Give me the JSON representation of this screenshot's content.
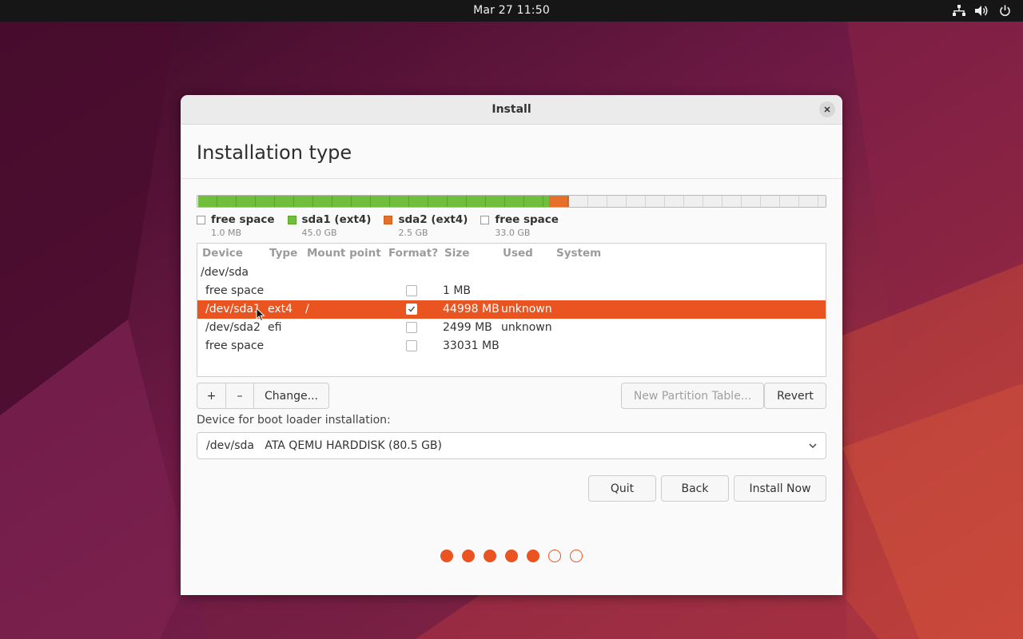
{
  "topbar": {
    "clock": "Mar 27  11:50",
    "tray_icons": [
      "network-icon",
      "volume-icon",
      "power-icon"
    ]
  },
  "dialog": {
    "title": "Install",
    "heading": "Installation type"
  },
  "partition_bar": {
    "segments": [
      {
        "name": "free space",
        "share": 0.0,
        "color": "#efefef"
      },
      {
        "name": "sda1",
        "share": 0.559,
        "color": "#6fbf3c"
      },
      {
        "name": "sda2",
        "share": 0.031,
        "color": "#e6702a"
      },
      {
        "name": "free space",
        "share": 0.41,
        "color": "#efefef"
      }
    ]
  },
  "legend": [
    {
      "label": "free space",
      "size": "1.0 MB",
      "color": "#ffffff"
    },
    {
      "label": "sda1 (ext4)",
      "size": "45.0 GB",
      "color": "#6fbf3c"
    },
    {
      "label": "sda2 (ext4)",
      "size": "2.5 GB",
      "color": "#e6702a"
    },
    {
      "label": "free space",
      "size": "33.0 GB",
      "color": "#ffffff"
    }
  ],
  "table": {
    "headers": {
      "device": "Device",
      "type": "Type",
      "mount": "Mount point",
      "format": "Format?",
      "size": "Size",
      "used": "Used",
      "system": "System"
    },
    "disk": "/dev/sda",
    "rows": [
      {
        "device": "free space",
        "type": "",
        "mount": "",
        "format": false,
        "size": "1 MB",
        "used": "",
        "selected": false
      },
      {
        "device": "/dev/sda1",
        "type": "ext4",
        "mount": "/",
        "format": true,
        "size": "44998 MB",
        "used": "unknown",
        "selected": true
      },
      {
        "device": "/dev/sda2",
        "type": "efi",
        "mount": "",
        "format": false,
        "size": "2499 MB",
        "used": "unknown",
        "selected": false
      },
      {
        "device": "free space",
        "type": "",
        "mount": "",
        "format": false,
        "size": "33031 MB",
        "used": "",
        "selected": false
      }
    ]
  },
  "buttons": {
    "add": "+",
    "remove": "–",
    "change": "Change...",
    "new_partition_table": "New Partition Table...",
    "revert": "Revert",
    "quit": "Quit",
    "back": "Back",
    "install_now": "Install Now"
  },
  "bootloader": {
    "label": "Device for boot loader installation:",
    "value": "/dev/sda   ATA QEMU HARDDISK (80.5 GB)"
  },
  "steps": {
    "total": 7,
    "completed": 5
  },
  "colors": {
    "accent": "#e95420",
    "sda1": "#6fbf3c",
    "sda2": "#e6702a"
  }
}
